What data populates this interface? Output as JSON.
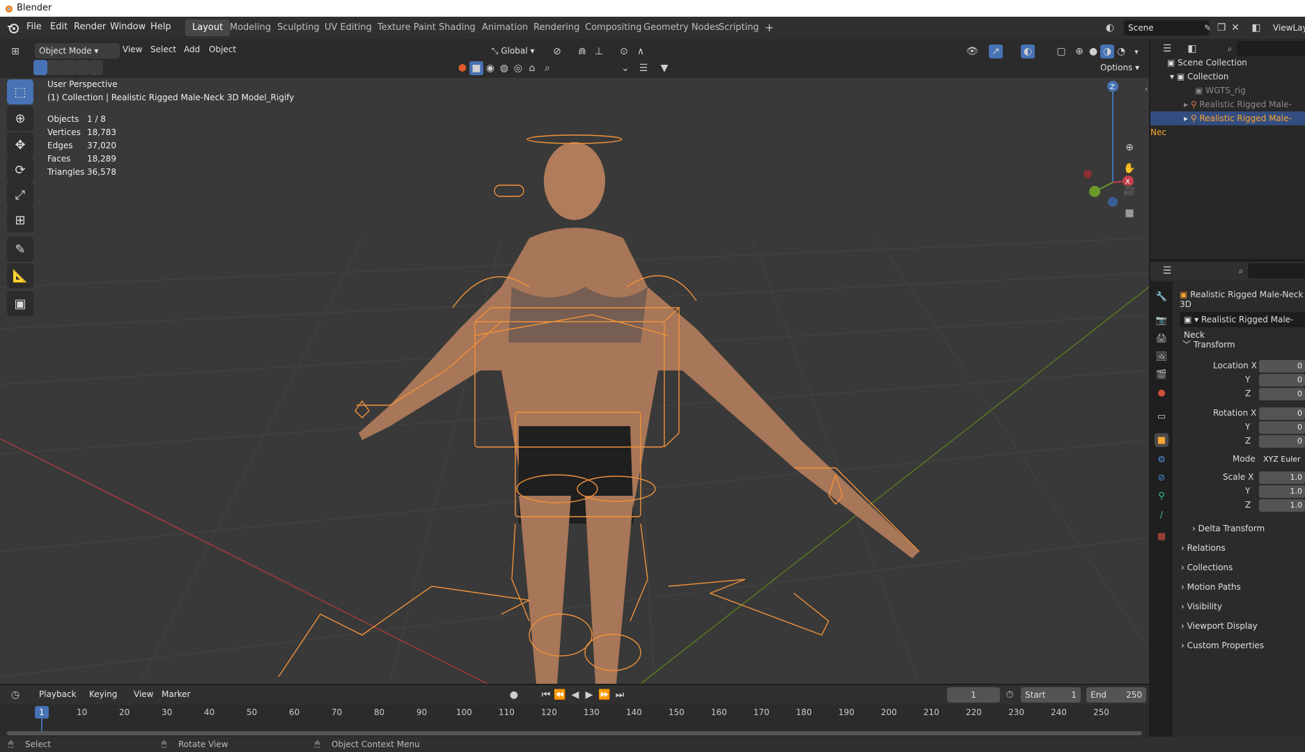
{
  "window": {
    "title": "Blender"
  },
  "menus": [
    "File",
    "Edit",
    "Render",
    "Window",
    "Help"
  ],
  "workspaces": [
    {
      "label": "Layout",
      "active": true
    },
    {
      "label": "Modeling"
    },
    {
      "label": "Sculpting"
    },
    {
      "label": "UV Editing"
    },
    {
      "label": "Texture Paint"
    },
    {
      "label": "Shading"
    },
    {
      "label": "Animation"
    },
    {
      "label": "Rendering"
    },
    {
      "label": "Compositing"
    },
    {
      "label": "Geometry Nodes"
    },
    {
      "label": "Scripting"
    }
  ],
  "add_workspace": "+",
  "scene": {
    "label": "Scene",
    "view_layer": "ViewLay"
  },
  "viewport_header": {
    "mode": "Object Mode",
    "menus": [
      "View",
      "Select",
      "Add",
      "Object"
    ],
    "transform_orientation": "Global",
    "options": "Options"
  },
  "viewport": {
    "perspective": "User Perspective",
    "collection_line": "(1) Collection | Realistic Rigged Male-Neck 3D Model_Rigify",
    "stats": [
      {
        "label": "Objects",
        "value": "1 / 8"
      },
      {
        "label": "Vertices",
        "value": "18,783"
      },
      {
        "label": "Edges",
        "value": "37,020"
      },
      {
        "label": "Faces",
        "value": "18,289"
      },
      {
        "label": "Triangles",
        "value": "36,578"
      }
    ],
    "gizmo": {
      "z": "Z",
      "x": "X"
    }
  },
  "outliner": {
    "items": [
      {
        "label": "Scene Collection"
      },
      {
        "label": "Collection"
      },
      {
        "label": "WGTS_rig"
      },
      {
        "label": "Realistic Rigged Male-Nec"
      },
      {
        "label": "Realistic Rigged Male-Nec",
        "selected": true
      }
    ]
  },
  "properties": {
    "object_name": "Realistic Rigged Male-Neck 3D",
    "data_name": "Realistic Rigged Male-Neck",
    "transform_header": "Transform",
    "location": {
      "label": "Location X",
      "x": "0",
      "y": "0",
      "z": "0"
    },
    "rotation": {
      "label": "Rotation X",
      "x": "0",
      "y": "0",
      "z": "0"
    },
    "mode": {
      "label": "Mode",
      "value": "XYZ Euler"
    },
    "scale": {
      "label": "Scale X",
      "x": "1.0",
      "y": "1.0",
      "z": "1.0"
    },
    "axis": {
      "y": "Y",
      "z": "Z"
    },
    "sections": [
      "Delta Transform",
      "Relations",
      "Collections",
      "Motion Paths",
      "Visibility",
      "Viewport Display",
      "Custom Properties"
    ]
  },
  "timeline": {
    "menus": [
      "Playback",
      "Keying",
      "View",
      "Marker"
    ],
    "current_frame": "1",
    "start_label": "Start",
    "start": "1",
    "end_label": "End",
    "end": "250",
    "ticks": [
      "1",
      "10",
      "20",
      "30",
      "40",
      "50",
      "60",
      "70",
      "80",
      "90",
      "100",
      "110",
      "120",
      "130",
      "140",
      "150",
      "160",
      "170",
      "180",
      "190",
      "200",
      "210",
      "220",
      "230",
      "240",
      "250"
    ]
  },
  "statusbar": {
    "select": "Select",
    "rotate": "Rotate View",
    "context": "Object Context Menu"
  },
  "colors": {
    "accent": "#4772b3",
    "rig": "#f0923a",
    "x_axis": "#c3404a",
    "y_axis": "#6a9a2a",
    "active_text": "#ffa630"
  }
}
